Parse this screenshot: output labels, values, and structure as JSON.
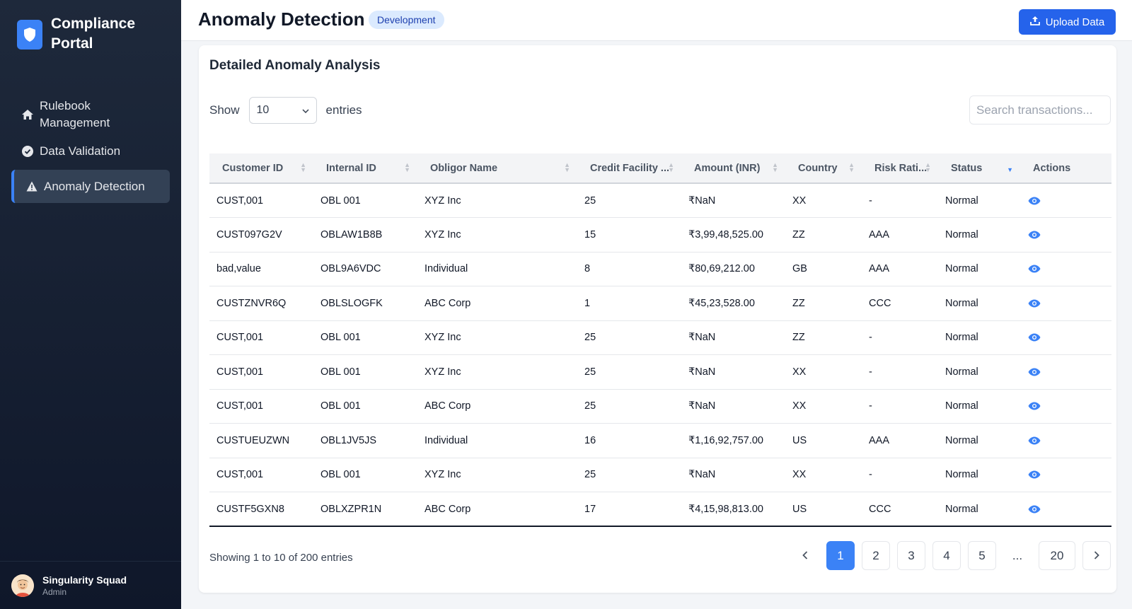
{
  "sidebar": {
    "brand_name": "Compliance Portal",
    "nav": [
      {
        "label": "Rulebook Management",
        "icon": "home-icon"
      },
      {
        "label": "Data Validation",
        "icon": "check-circle-icon"
      },
      {
        "label": "Anomaly Detection",
        "icon": "warning-icon",
        "active": true
      }
    ],
    "user": {
      "name": "Singularity Squad",
      "role": "Admin"
    }
  },
  "header": {
    "title": "Anomaly Detection",
    "env_badge": "Development",
    "upload_label": "Upload Data"
  },
  "card": {
    "title": "Detailed Anomaly Analysis",
    "show_label": "Show",
    "entries_value": "10",
    "entries_label": "entries",
    "search_placeholder": "Search transactions..."
  },
  "table": {
    "columns": [
      "Customer ID",
      "Internal ID",
      "Obligor Name",
      "Credit Facility ...",
      "Amount (INR)",
      "Country",
      "Risk Rati...",
      "Status",
      "Actions"
    ],
    "rows": [
      [
        "CUST,001",
        "OBL 001",
        "XYZ Inc",
        "25",
        "₹NaN",
        "XX",
        "-",
        "Normal"
      ],
      [
        "CUST097G2V",
        "OBLAW1B8B",
        "XYZ Inc",
        "15",
        "₹3,99,48,525.00",
        "ZZ",
        "AAA",
        "Normal"
      ],
      [
        "bad,value",
        "OBL9A6VDC",
        "Individual",
        "8",
        "₹80,69,212.00",
        "GB",
        "AAA",
        "Normal"
      ],
      [
        "CUSTZNVR6Q",
        "OBLSLOGFK",
        "ABC Corp",
        "1",
        "₹45,23,528.00",
        "ZZ",
        "CCC",
        "Normal"
      ],
      [
        "CUST,001",
        "OBL 001",
        "XYZ Inc",
        "25",
        "₹NaN",
        "ZZ",
        "-",
        "Normal"
      ],
      [
        "CUST,001",
        "OBL 001",
        "XYZ Inc",
        "25",
        "₹NaN",
        "XX",
        "-",
        "Normal"
      ],
      [
        "CUST,001",
        "OBL 001",
        "ABC Corp",
        "25",
        "₹NaN",
        "XX",
        "-",
        "Normal"
      ],
      [
        "CUSTUEUZWN",
        "OBL1JV5JS",
        "Individual",
        "16",
        "₹1,16,92,757.00",
        "US",
        "AAA",
        "Normal"
      ],
      [
        "CUST,001",
        "OBL 001",
        "XYZ Inc",
        "25",
        "₹NaN",
        "XX",
        "-",
        "Normal"
      ],
      [
        "CUSTF5GXN8",
        "OBLXZPR1N",
        "ABC Corp",
        "17",
        "₹4,15,98,813.00",
        "US",
        "CCC",
        "Normal"
      ]
    ]
  },
  "footer": {
    "info": "Showing 1 to 10 of 200 entries",
    "pages": [
      "1",
      "2",
      "3",
      "4",
      "5",
      "...",
      "20"
    ],
    "current_page": "1"
  },
  "colors": {
    "accent": "#3b82f6",
    "sidebar_bg": "#0f172a"
  }
}
